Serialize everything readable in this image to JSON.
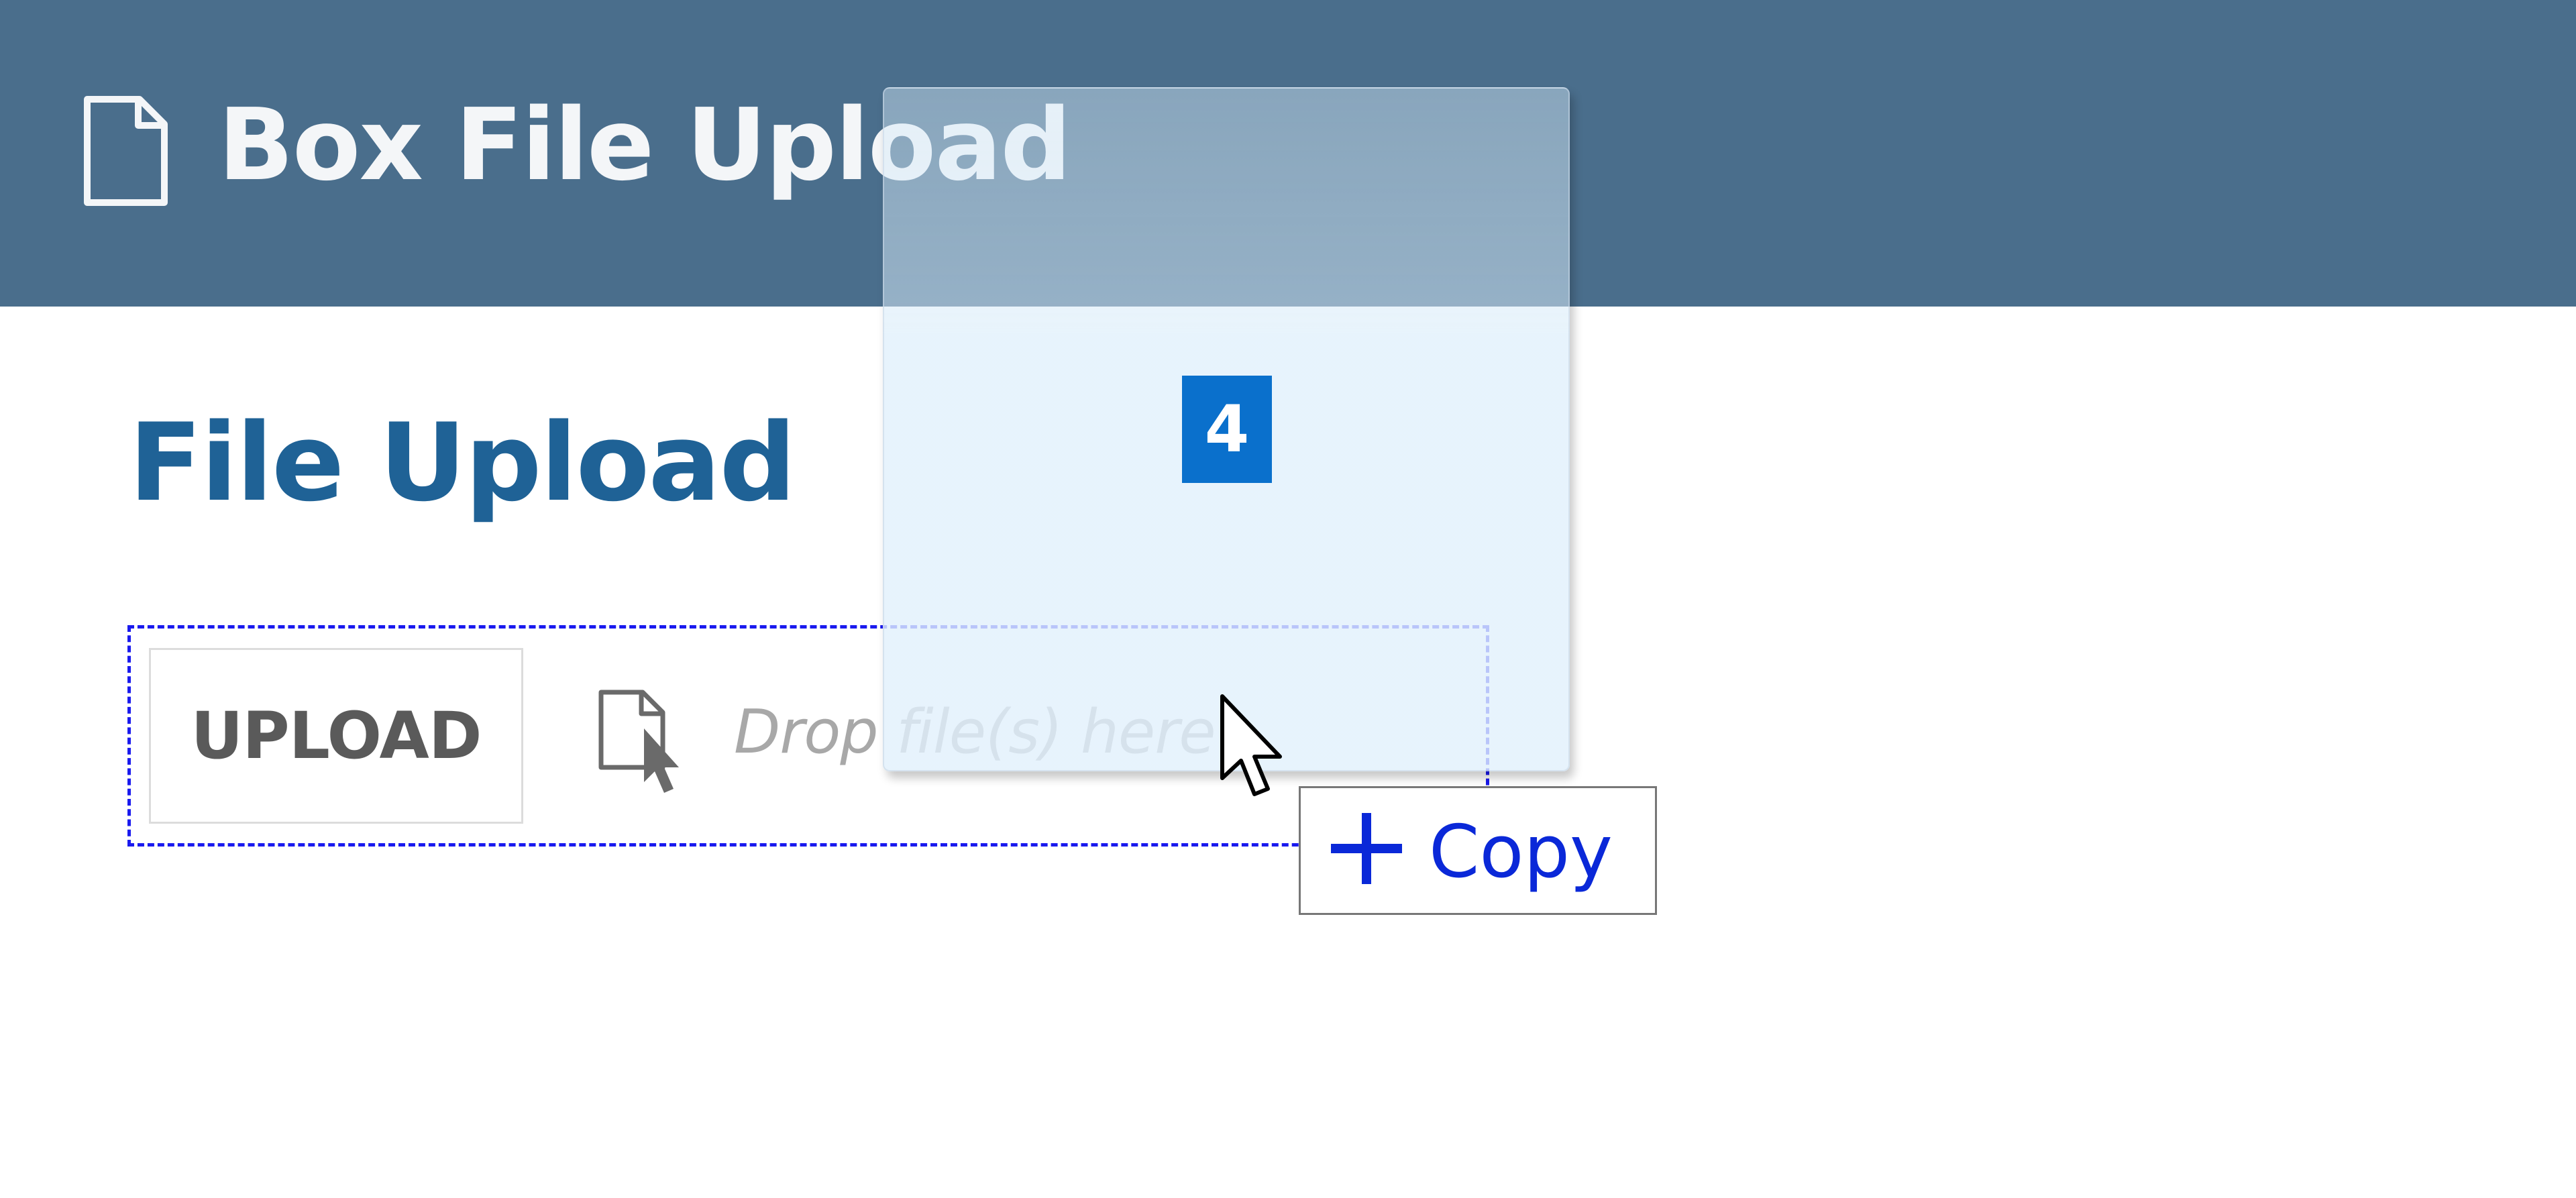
{
  "header": {
    "icon": "file-icon",
    "title": "Box File Upload"
  },
  "main": {
    "title": "File Upload"
  },
  "upload": {
    "button_label": "UPLOAD",
    "drop_icon": "file-cursor-icon",
    "drop_hint": "Drop file(s) here"
  },
  "drag": {
    "file_count": "4",
    "effect_icon": "plus-icon",
    "effect_label": "Copy"
  },
  "colors": {
    "header_background": "#4a6e8c",
    "title_color": "#1f6296",
    "count_badge": "#0a70cc",
    "dropzone_border": "#1a1aee",
    "copy_label": "#0a28d8"
  }
}
